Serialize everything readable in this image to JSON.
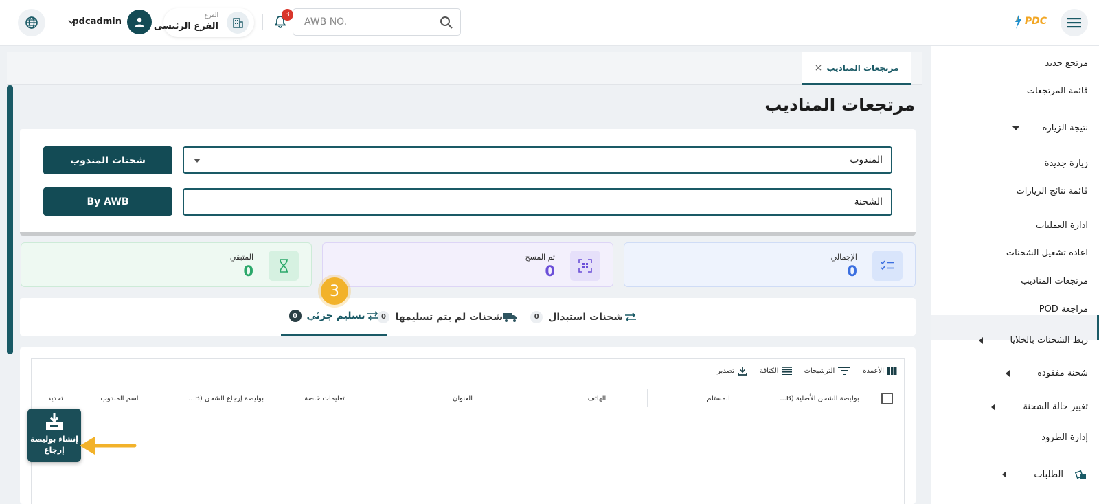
{
  "header": {
    "search_placeholder": "AWB NO.",
    "notification_count": "3",
    "branch_label": "الفرع",
    "branch_name": "الفرع الرئيسى",
    "username": "pdcadmin",
    "logo_text": "PDC"
  },
  "sidebar": {
    "items": [
      {
        "label": "مرتجع جديد"
      },
      {
        "label": "قائمة المرتجعات"
      },
      {
        "label": "نتيجة الزيارة"
      },
      {
        "label": "زيارة جديدة"
      },
      {
        "label": "قائمة نتائج الزيارات"
      },
      {
        "label": "ادارة العمليات"
      },
      {
        "label": "اعادة تشغيل الشحنات"
      },
      {
        "label": "مرتجعات المناديب"
      },
      {
        "label": "مراجعة POD"
      },
      {
        "label": "ربط الشحنات بالخلايا"
      },
      {
        "label": "شحنة مفقودة"
      },
      {
        "label": "تغيير حالة الشحنة"
      },
      {
        "label": "إدارة الطرود"
      },
      {
        "label": "الطلبات"
      }
    ]
  },
  "tab": {
    "label": "مرتجعات المناديب",
    "close": "×"
  },
  "page": {
    "title": "مرتجعات المناديب"
  },
  "filters": {
    "courier_value": "المندوب",
    "awb_value": "الشحنة",
    "courier_button": "شحنات المندوب",
    "awb_button": "By AWB"
  },
  "stats": {
    "total_label": "الإجمالي",
    "total_value": "0",
    "scanned_label": "تم المسح",
    "scanned_value": "0",
    "remaining_label": "المتبقي",
    "remaining_value": "0"
  },
  "page_tabs": [
    {
      "label": "شحنات استبدال",
      "count": "0"
    },
    {
      "label": "شحنات لم يتم تسليمها",
      "count": "0"
    },
    {
      "label": "تسليم جزئي",
      "count": "0"
    }
  ],
  "step_number": "3",
  "grid": {
    "toolbar": {
      "columns": "الأعمدة",
      "filters": "الترشيحات",
      "density": "الكثافة",
      "export": "تصدير"
    },
    "columns": [
      "بوليصة الشحن الأصلية (B...",
      "المستلم",
      "الهاتف",
      "العنوان",
      "تعليمات خاصة",
      "بوليصة إرجاع الشحن (B...",
      "اسم المندوب",
      "تحديد"
    ]
  },
  "fab": {
    "line1": "إنشاء بوليصة",
    "line2": "إرجاع"
  },
  "colors": {
    "primary": "#134b55",
    "accent": "#1a5a66",
    "step": "#f2b22a",
    "total": "#3b6fe0",
    "scanned": "#6b4fd8",
    "remaining": "#2ba86a"
  }
}
